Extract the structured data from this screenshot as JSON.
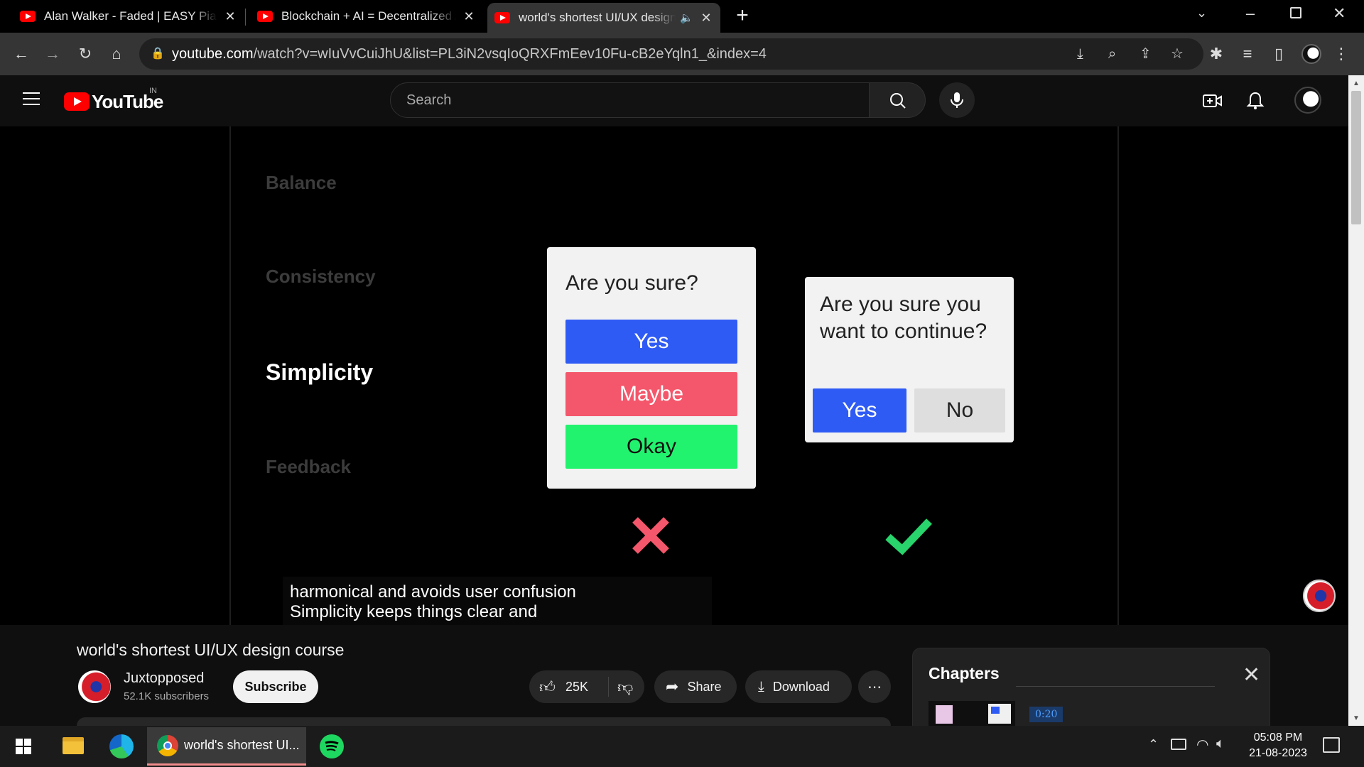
{
  "browser": {
    "tabs": [
      {
        "title": "Alan Walker - Faded | EASY Piano",
        "active": false
      },
      {
        "title": "Blockchain + AI = Decentralized AI",
        "active": false
      },
      {
        "title": "world's shortest UI/UX design course",
        "active": true
      }
    ],
    "address": {
      "host": "youtube.com",
      "path": "/watch?v=wIuVvCuiJhU&list=PL3iN2vsqIoQRXFmEev10Fu-cB2eYqln1_&index=4"
    }
  },
  "youtube": {
    "logo_text": "YouTube",
    "region": "IN",
    "search": {
      "placeholder": "Search"
    }
  },
  "video": {
    "principles": [
      "Balance",
      "Consistency",
      "Simplicity",
      "Feedback"
    ],
    "active_principle": "Simplicity",
    "dialog_bad": {
      "question": "Are you sure?",
      "buttons": [
        {
          "label": "Yes",
          "color": "#2f5bf5"
        },
        {
          "label": "Maybe",
          "color": "#f4576b"
        },
        {
          "label": "Okay",
          "color": "#22f36f"
        }
      ]
    },
    "dialog_good": {
      "question_line1": "Are you sure you",
      "question_line2": "want to continue?",
      "yes_label": "Yes",
      "no_label": "No"
    },
    "caption_line1": "harmonical and avoids user confusion",
    "caption_line2": "Simplicity keeps things clear and",
    "bad_mark_color": "#f4576b",
    "good_mark_color": "#28d46b"
  },
  "meta": {
    "title": "world's shortest UI/UX design course",
    "channel": "Juxtopposed",
    "subscribers": "52.1K subscribers",
    "subscribe_label": "Subscribe",
    "likes": "25K",
    "share_label": "Share",
    "download_label": "Download"
  },
  "chapters": {
    "heading": "Chapters",
    "first_time": "0:20"
  },
  "taskbar": {
    "chrome_label": "world's shortest UI...",
    "time": "05:08 PM",
    "date": "21-08-2023"
  }
}
